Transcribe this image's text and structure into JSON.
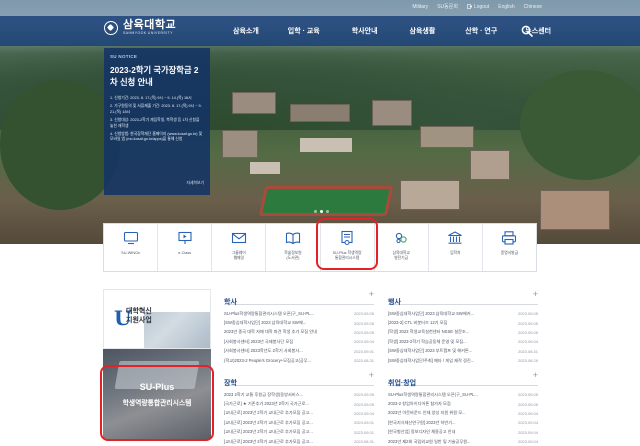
{
  "utility": [
    "Military",
    "SU동문회",
    "Logout",
    "English",
    "Chinese"
  ],
  "logo": {
    "ko": "삼육대학교",
    "en": "SAHMYOOK UNIVERSITY"
  },
  "menu": [
    "삼육소개",
    "입학 · 교육",
    "학사안내",
    "삼육생활",
    "산학 · 연구",
    "뉴스센터"
  ],
  "notice": {
    "label": "SU NOTICE",
    "title": "2023-2학기 국가장학금 2차 신청 안내",
    "lines": [
      "1. 신청기간: 2023. 8. 17.(목) 9시 ~ 9. 14.(목) 18시",
      "2. 가구원동의 및 서류제출 기간: 2023. 8. 17.(목) 9시 ~ 9. 21.(목) 18시",
      "3. 신청대상: 2023-2학기 재입학생, 복학생 등 1차 신청을 놓친 재학생",
      "4. 신청방법: 한국장학재단 홈페이지 (www.kosaf.go.kr) 및 모바일 앱 (mo.kosaf.go.kr/apps)을 통해 신청"
    ],
    "more": "자세히보기"
  },
  "quick_links": [
    {
      "label": "SU-WINGs"
    },
    {
      "label": "e-Class"
    },
    {
      "label": "그룹웨어\n웹메일"
    },
    {
      "label": "학술정보원\n(도서관)"
    },
    {
      "label": "SU-Plus 학생역량\n통합관리시스템"
    },
    {
      "label": "삼육대학교\n발전기금"
    },
    {
      "label": "입학처"
    },
    {
      "label": "증명서발급"
    }
  ],
  "promo": {
    "top_line1": "대학혁신",
    "top_line2": "지원사업",
    "bottom_line1": "SU-Plus",
    "bottom_line2": "학생역량통합관리시스템"
  },
  "boards": {
    "haksa": {
      "title": "학사",
      "items": [
        {
          "t": "SU-Plus학생역량통합관리시스템 오픈(구_SU-PL...",
          "d": "2023.09.05"
        },
        {
          "t": "[SW중심대학사업단] 2023 삼육대학교 SW해...",
          "d": "2023.09.05"
        },
        {
          "t": "2023년 중국 대학 자매 대학 파견 학생 추가 모집 안내",
          "d": "2023.09.05"
        },
        {
          "t": "[사회봉사센터] 2023년 국제봉사단 모집",
          "d": "2023.09.04"
        },
        {
          "t": "[사회봉사센터] 2023학년도 2학기 사회봉사...",
          "d": "2023.09.01"
        },
        {
          "t": "(학교)2023-2 People's Grocery+모집공고(공무...",
          "d": "2023.08.31"
        }
      ]
    },
    "haengsa": {
      "title": "행사",
      "items": [
        {
          "t": "[SW중심대학사업단] 2023 삼육대학교 SW해커...",
          "d": "2023.09.05"
        },
        {
          "t": "[2023-2] CTL 비봇터즈 12기 모집",
          "d": "2023.09.05"
        },
        {
          "t": "[학생] 2023 학생교육실천센터 NSSE 설문조...",
          "d": "2023.09.05"
        },
        {
          "t": "[학생] 2023-2학기 학습공동체 운영 및 모집...",
          "d": "2023.09.04"
        },
        {
          "t": "[SW중심대학사업단] 2023 부트캠프 및 해커톤...",
          "d": "2023.08.31"
        },
        {
          "t": "[SW중심대학사업단/주최] 메타 / 게임 제작 경진...",
          "d": "2023.08.29"
        }
      ]
    },
    "janghak": {
      "title": "장학",
      "items": [
        {
          "t": "2023 2학기 교통 후원금 장학생(동방서비스...",
          "d": "2023.09.05"
        },
        {
          "t": "[국가근로] ★ 기존추가 2023년 2학기 국가근로...",
          "d": "2023.09.05"
        },
        {
          "t": "[교내근로] 2023년 2학기 교내근로 추가모집 공고...",
          "d": "2023.09.04"
        },
        {
          "t": "[교내근로] 2023년 2학기 교내근로 추가모집 공고...",
          "d": "2023.09.01"
        },
        {
          "t": "[교내근로] 2023년 2학기 교내근로 추가모집 공고...",
          "d": "2023.09.01"
        },
        {
          "t": "[교내근로] 2023년 2학기 교내근로 추가모집 공고...",
          "d": "2023.08.31"
        }
      ]
    },
    "chwieop": {
      "title": "취업·창업",
      "items": [
        {
          "t": "SU-Plus학생역량통합관리시스템 오픈(구_SU-PL...",
          "d": "2023.09.05"
        },
        {
          "t": "2023-2 창업아이디어톤 참가자 모집",
          "d": "2023.09.05"
        },
        {
          "t": "2023년 아웃바운드 인재 양성 지원 위원 모...",
          "d": "2023.09.04"
        },
        {
          "t": "[한국지식재산연구원] 2023년 하반기...",
          "d": "2023.09.04"
        },
        {
          "t": "[한국형산업] 정보디자인 채용공고 안내",
          "d": "2023.09.04"
        },
        {
          "t": "2023년 제2회 국립외교원 일반 및 기술공무원...",
          "d": "2023.09.04"
        }
      ]
    }
  },
  "colors": {
    "nav": "#183e76",
    "accent": "#1e4b8f",
    "highlight": "#e32227"
  }
}
